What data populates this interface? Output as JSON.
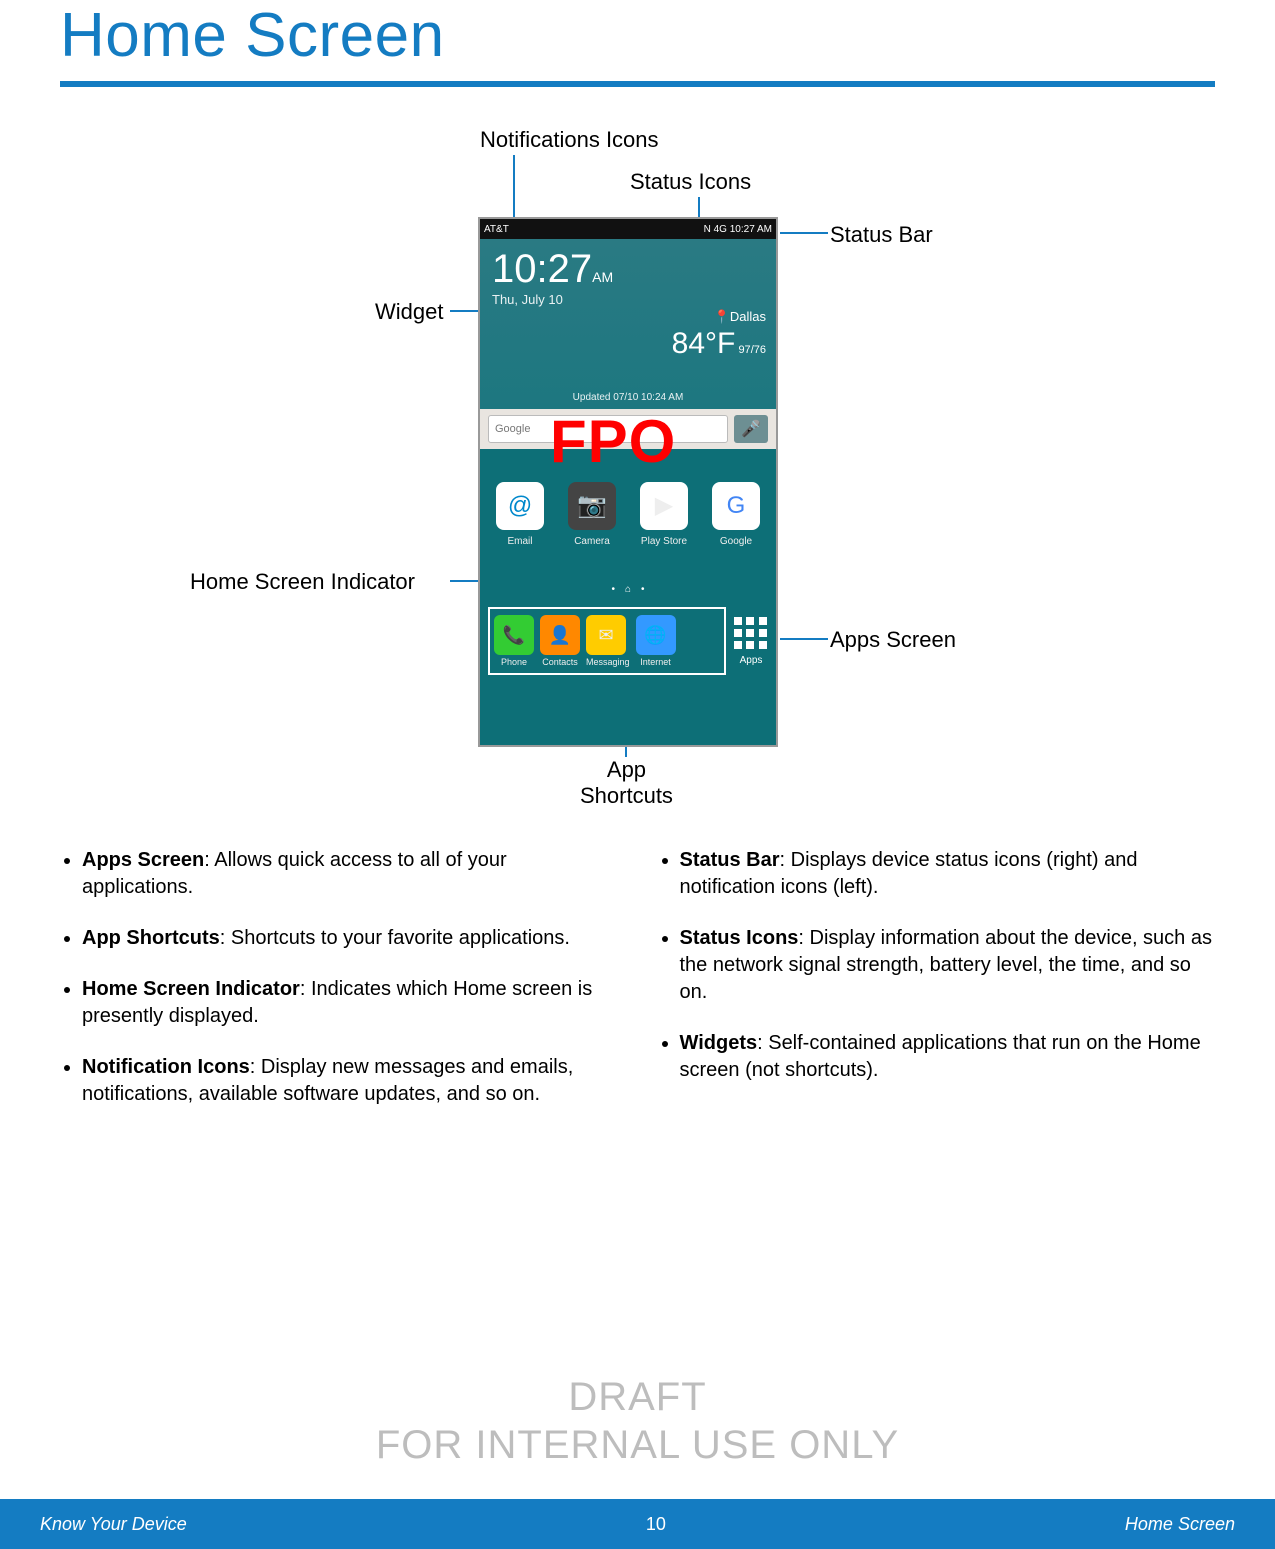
{
  "page": {
    "title": "Home Screen"
  },
  "callouts": {
    "notifications_icons": "Notifications Icons",
    "status_icons": "Status Icons",
    "status_bar": "Status Bar",
    "widget": "Widget",
    "home_screen_indicator": "Home Screen Indicator",
    "apps_screen": "Apps Screen",
    "app_shortcuts": "App\nShortcuts"
  },
  "phone": {
    "carrier": "AT&T",
    "status_right": "N 4G 10:27 AM",
    "widget": {
      "time": "10:27",
      "am": "AM",
      "date": "Thu, July 10",
      "location_prefix": "Dallas",
      "temp": "84°F",
      "hi": "97",
      "lo": "76",
      "updated": "Updated 07/10 10:24 AM"
    },
    "search_label": "Google",
    "icons": [
      "Email",
      "Camera",
      "Play Store",
      "Google"
    ],
    "dock": [
      "Phone",
      "Contacts",
      "Messaging",
      "Internet"
    ],
    "apps_label": "Apps"
  },
  "fpo": "FPO",
  "bullets_left": [
    {
      "b": "Apps Screen",
      "t": ": Allows quick access to all of your applications."
    },
    {
      "b": "App Shortcuts",
      "t": ": Shortcuts to your favorite applications."
    },
    {
      "b": "Home Screen Indicator",
      "t": ": Indicates which Home screen is presently displayed."
    },
    {
      "b": "Notification Icons",
      "t": ": Display new messages and emails, notifications, available software updates, and so on."
    }
  ],
  "bullets_right": [
    {
      "b": "Status Bar",
      "t": ": Displays device status icons (right) and notification icons (left)."
    },
    {
      "b": "Status Icons",
      "t": ": Display information about the device, such as the network signal strength, battery level, the time, and so on."
    },
    {
      "b": "Widgets",
      "t": ": Self-contained applications that run on the Home screen (not shortcuts)."
    }
  ],
  "watermark": {
    "top": "DRAFT",
    "bottom": "FOR INTERNAL USE ONLY"
  },
  "footer": {
    "left": "Know Your Device",
    "page": "10",
    "right": "Home Screen"
  }
}
